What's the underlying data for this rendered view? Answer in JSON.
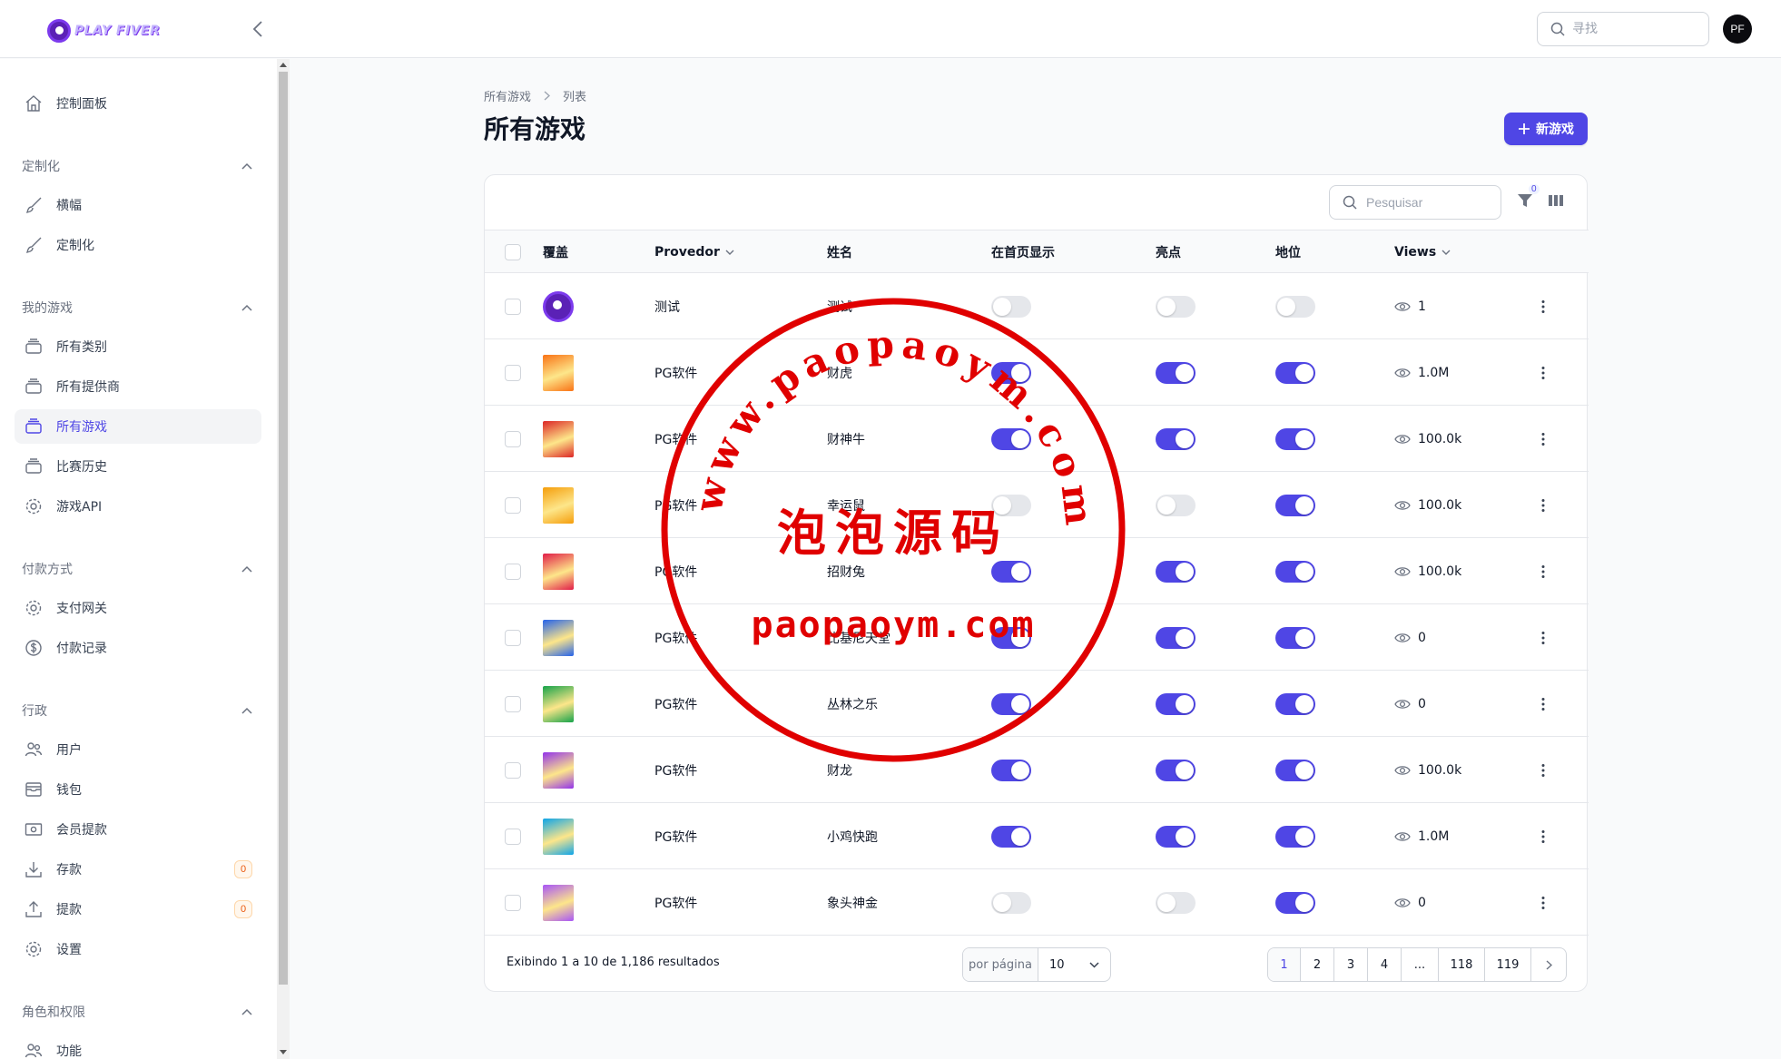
{
  "app": {
    "logo_text": "PLAY FIVER"
  },
  "topbar": {
    "search_placeholder": "寻找",
    "avatar_initials": "PF"
  },
  "sidebar": {
    "dashboard": "控制面板",
    "groups": {
      "custom": "定制化",
      "mygames": "我的游戏",
      "payment": "付款方式",
      "admin": "行政",
      "roles": "角色和权限"
    },
    "items": {
      "banner": "横幅",
      "customize": "定制化",
      "categories": "所有类别",
      "providers": "所有提供商",
      "allgames": "所有游戏",
      "matchhistory": "比赛历史",
      "gameapi": "游戏API",
      "gateway": "支付网关",
      "paylog": "付款记录",
      "users": "用户",
      "wallet": "钱包",
      "withdraw_member": "会员提款",
      "deposit": "存款",
      "withdraw": "提款",
      "settings": "设置",
      "features": "功能"
    },
    "badges": {
      "deposit": "0",
      "withdraw": "0"
    }
  },
  "breadcrumb": {
    "root": "所有游戏",
    "current": "列表"
  },
  "page": {
    "title": "所有游戏",
    "new_button": "新游戏"
  },
  "table": {
    "search_placeholder": "Pesquisar",
    "filter_count": "0",
    "headers": {
      "cover": "覆盖",
      "provider": "Provedor",
      "name": "姓名",
      "home": "在首页显示",
      "highlight": "亮点",
      "status": "地位",
      "views": "Views"
    },
    "rows": [
      {
        "provider": "测试",
        "name": "测试",
        "home": false,
        "highlight": false,
        "status": false,
        "views": "1"
      },
      {
        "provider": "PG软件",
        "name": "财虎",
        "home": true,
        "highlight": true,
        "status": true,
        "views": "1.0M"
      },
      {
        "provider": "PG软件",
        "name": "财神牛",
        "home": true,
        "highlight": true,
        "status": true,
        "views": "100.0k"
      },
      {
        "provider": "PG软件",
        "name": "幸运鼠",
        "home": false,
        "highlight": false,
        "status": true,
        "views": "100.0k"
      },
      {
        "provider": "PG软件",
        "name": "招财兔",
        "home": true,
        "highlight": true,
        "status": true,
        "views": "100.0k"
      },
      {
        "provider": "PG软件",
        "name": "比基尼天堂",
        "home": true,
        "highlight": true,
        "status": true,
        "views": "0"
      },
      {
        "provider": "PG软件",
        "name": "丛林之乐",
        "home": true,
        "highlight": true,
        "status": true,
        "views": "0"
      },
      {
        "provider": "PG软件",
        "name": "财龙",
        "home": true,
        "highlight": true,
        "status": true,
        "views": "100.0k"
      },
      {
        "provider": "PG软件",
        "name": "小鸡快跑",
        "home": true,
        "highlight": true,
        "status": true,
        "views": "1.0M"
      },
      {
        "provider": "PG软件",
        "name": "象头神金",
        "home": false,
        "highlight": false,
        "status": true,
        "views": "0"
      }
    ],
    "thumb_colors": [
      "#7c3aed",
      "#f97316",
      "#dc2626",
      "#f59e0b",
      "#e11d48",
      "#2563eb",
      "#16a34a",
      "#9333ea",
      "#0ea5e9",
      "#a855f7"
    ],
    "footer": {
      "results": "Exibindo 1 a 10 de 1,186 resultados",
      "per_page_label": "por página",
      "per_page_value": "10",
      "pages": [
        "1",
        "2",
        "3",
        "4",
        "...",
        "118",
        "119"
      ]
    }
  },
  "watermark": {
    "arc_text": "www.paopaoym.com",
    "center_text": "泡泡源码",
    "bottom_text": "paopaoym.com",
    "color": "#e00000"
  },
  "colors": {
    "accent": "#4f46e5"
  }
}
